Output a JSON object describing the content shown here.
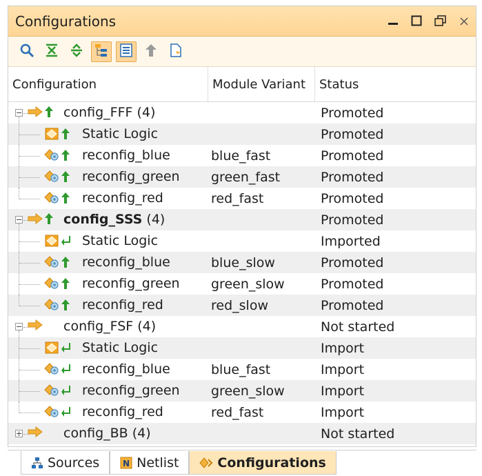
{
  "panel": {
    "title": "Configurations",
    "window_controls": [
      "minimize-icon",
      "maximize-icon",
      "restore-icon",
      "close-icon"
    ]
  },
  "toolbar": {
    "buttons": [
      {
        "icon": "search-icon",
        "active": false
      },
      {
        "icon": "collapse-all-icon",
        "active": false
      },
      {
        "icon": "expand-all-icon",
        "active": false
      },
      {
        "icon": "hierarchy-icon",
        "active": true
      },
      {
        "icon": "flat-view-icon",
        "active": true
      },
      {
        "icon": "promote-icon",
        "active": false
      },
      {
        "icon": "report-icon",
        "active": false
      }
    ]
  },
  "table": {
    "headers": [
      "Configuration",
      "Module Variant",
      "Status"
    ],
    "rows": [
      {
        "level": 0,
        "expander": "−",
        "icons": [
          "arrow-right-icon",
          "promote-up-icon"
        ],
        "name": "config_FFF",
        "count": " (4)",
        "bold": false,
        "variant": "",
        "status": "Promoted"
      },
      {
        "level": 1,
        "expander": "",
        "icons": [
          "static-logic-icon",
          "promote-up-icon"
        ],
        "name": "Static Logic",
        "count": "",
        "bold": false,
        "variant": "",
        "status": "Promoted"
      },
      {
        "level": 1,
        "expander": "",
        "icons": [
          "reconfig-module-icon",
          "promote-up-icon"
        ],
        "name": "reconfig_blue",
        "count": "",
        "bold": false,
        "variant": "blue_fast",
        "status": "Promoted"
      },
      {
        "level": 1,
        "expander": "",
        "icons": [
          "reconfig-module-icon",
          "promote-up-icon"
        ],
        "name": "reconfig_green",
        "count": "",
        "bold": false,
        "variant": "green_fast",
        "status": "Promoted"
      },
      {
        "level": 1,
        "expander": "",
        "icons": [
          "reconfig-module-icon",
          "promote-up-icon"
        ],
        "name": "reconfig_red",
        "count": "",
        "bold": false,
        "variant": "red_fast",
        "status": "Promoted"
      },
      {
        "level": 0,
        "expander": "−",
        "icons": [
          "arrow-right-icon",
          "promote-up-icon"
        ],
        "name": "config_SSS",
        "count": " (4)",
        "bold": true,
        "variant": "",
        "status": "Promoted"
      },
      {
        "level": 1,
        "expander": "",
        "icons": [
          "static-logic-icon",
          "import-icon"
        ],
        "name": "Static Logic",
        "count": "",
        "bold": false,
        "variant": "",
        "status": "Imported"
      },
      {
        "level": 1,
        "expander": "",
        "icons": [
          "reconfig-module-icon",
          "promote-up-icon"
        ],
        "name": "reconfig_blue",
        "count": "",
        "bold": false,
        "variant": "blue_slow",
        "status": "Promoted"
      },
      {
        "level": 1,
        "expander": "",
        "icons": [
          "reconfig-module-icon",
          "promote-up-icon"
        ],
        "name": "reconfig_green",
        "count": "",
        "bold": false,
        "variant": "green_slow",
        "status": "Promoted"
      },
      {
        "level": 1,
        "expander": "",
        "icons": [
          "reconfig-module-icon",
          "promote-up-icon"
        ],
        "name": "reconfig_red",
        "count": "",
        "bold": false,
        "variant": "red_slow",
        "status": "Promoted"
      },
      {
        "level": 0,
        "expander": "−",
        "icons": [
          "arrow-right-icon"
        ],
        "name": "config_FSF",
        "count": " (4)",
        "bold": false,
        "variant": "",
        "status": "Not started"
      },
      {
        "level": 1,
        "expander": "",
        "icons": [
          "static-logic-icon",
          "import-icon"
        ],
        "name": "Static Logic",
        "count": "",
        "bold": false,
        "variant": "",
        "status": "Import"
      },
      {
        "level": 1,
        "expander": "",
        "icons": [
          "reconfig-module-icon",
          "import-icon"
        ],
        "name": "reconfig_blue",
        "count": "",
        "bold": false,
        "variant": "blue_fast",
        "status": "Import"
      },
      {
        "level": 1,
        "expander": "",
        "icons": [
          "reconfig-module-icon",
          "import-icon"
        ],
        "name": "reconfig_green",
        "count": "",
        "bold": false,
        "variant": "green_slow",
        "status": "Import"
      },
      {
        "level": 1,
        "expander": "",
        "icons": [
          "reconfig-module-icon",
          "import-icon"
        ],
        "name": "reconfig_red",
        "count": "",
        "bold": false,
        "variant": "red_fast",
        "status": "Import"
      },
      {
        "level": 0,
        "expander": "+",
        "icons": [
          "arrow-right-icon"
        ],
        "name": "config_BB",
        "count": " (4)",
        "bold": false,
        "variant": "",
        "status": "Not started"
      }
    ]
  },
  "tabs": [
    {
      "label": "Sources",
      "icon": "sources-icon",
      "active": false
    },
    {
      "label": "Netlist",
      "icon": "netlist-icon",
      "active": false
    },
    {
      "label": "Configurations",
      "icon": "configurations-icon",
      "active": true
    }
  ],
  "colors": {
    "title_bg": "#ffd594",
    "arrow": "#f2b13a",
    "promote_green": "#2e9a2e",
    "import_green": "#2e9a2e",
    "static_logic": "#f5a623"
  }
}
